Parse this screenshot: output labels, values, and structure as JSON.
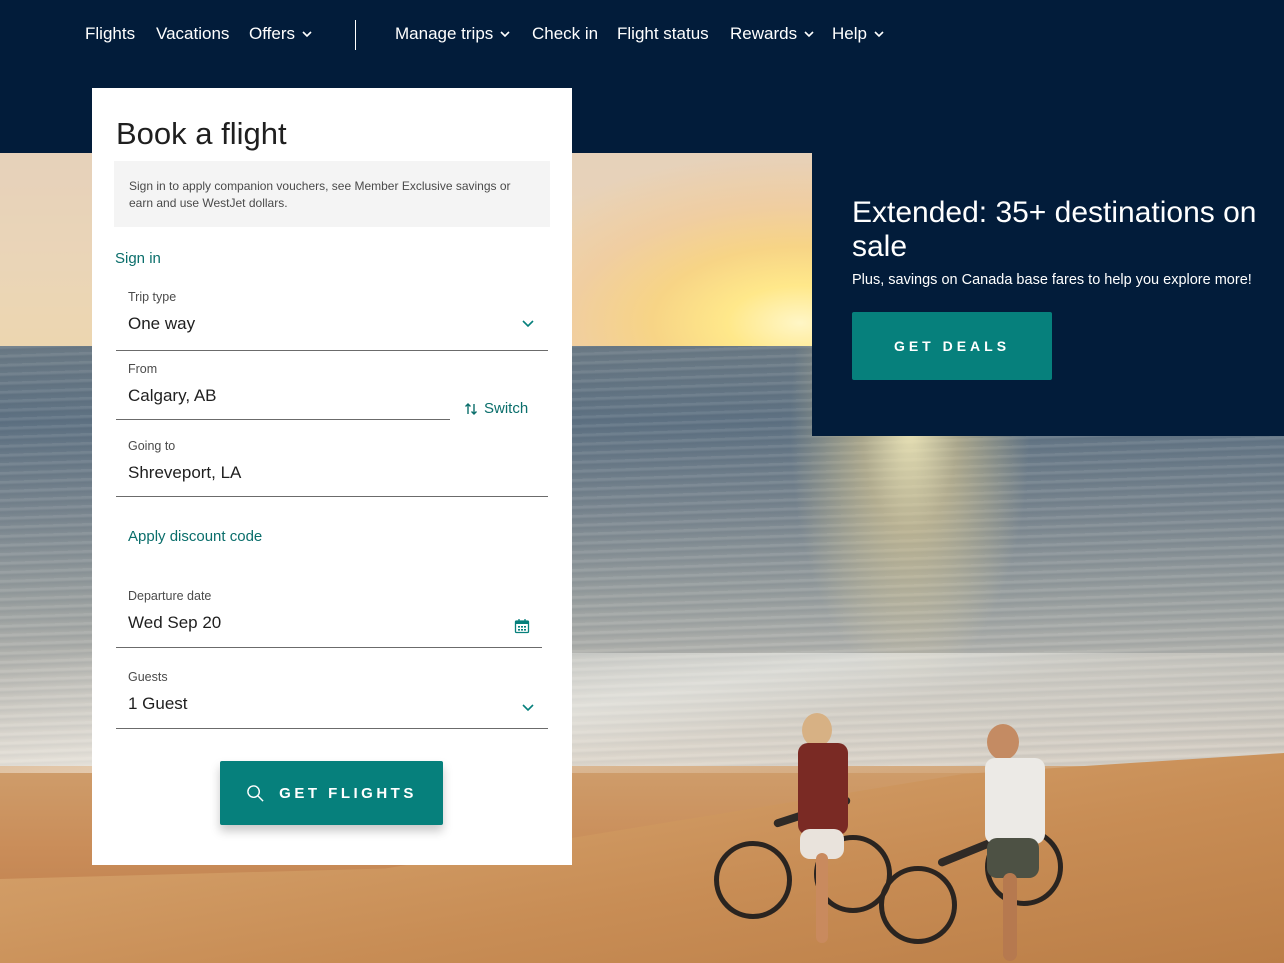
{
  "nav": {
    "items": [
      {
        "label": "Flights",
        "dropdown": false
      },
      {
        "label": "Vacations",
        "dropdown": false
      },
      {
        "label": "Offers",
        "dropdown": true
      },
      {
        "label": "Manage trips",
        "dropdown": true
      },
      {
        "label": "Check in",
        "dropdown": false
      },
      {
        "label": "Flight status",
        "dropdown": false
      },
      {
        "label": "Rewards",
        "dropdown": true
      },
      {
        "label": "Help",
        "dropdown": true
      }
    ]
  },
  "booking": {
    "title": "Book a flight",
    "signin_notice": "Sign in to apply companion vouchers, see Member Exclusive savings or earn and use WestJet dollars.",
    "signin_link": "Sign in",
    "trip_type": {
      "label": "Trip type",
      "value": "One way"
    },
    "from": {
      "label": "From",
      "value": "Calgary, AB"
    },
    "switch_label": "Switch",
    "going_to": {
      "label": "Going to",
      "value": "Shreveport, LA"
    },
    "discount_link": "Apply discount code",
    "departure": {
      "label": "Departure date",
      "value": "Wed Sep 20"
    },
    "guests": {
      "label": "Guests",
      "value": "1 Guest"
    },
    "submit_label": "GET FLIGHTS"
  },
  "promo": {
    "title": "Extended: 35+ destinations on sale",
    "subtitle": "Plus, savings on Canada base fares to help you explore more!",
    "button_label": "GET DEALS"
  },
  "colors": {
    "navy": "#021c3a",
    "teal": "#06807c",
    "link_teal": "#0a6e6b"
  },
  "icons": [
    "chevron-down-icon",
    "switch-arrows-icon",
    "calendar-icon",
    "search-icon"
  ]
}
